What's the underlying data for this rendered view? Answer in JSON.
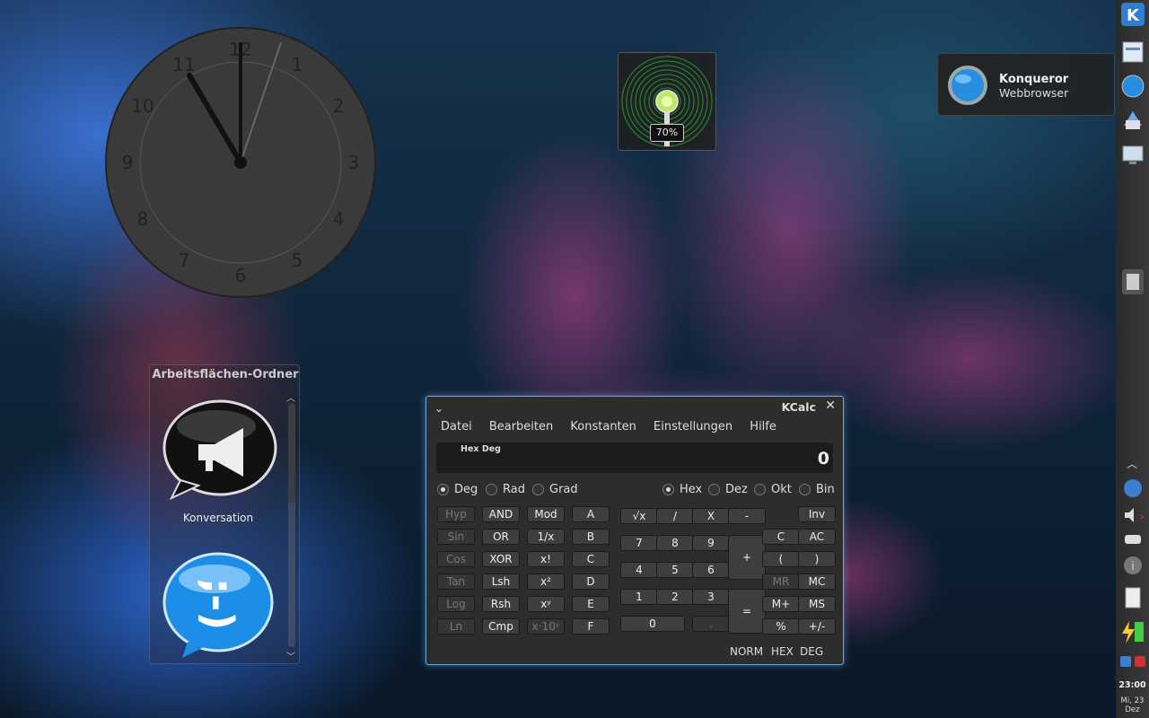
{
  "clock": {
    "numerals": [
      "12",
      "1",
      "2",
      "3",
      "4",
      "5",
      "6",
      "7",
      "8",
      "9",
      "10",
      "11"
    ]
  },
  "meter": {
    "percent_label": "70%",
    "level": 70
  },
  "tooltip": {
    "title": "Konqueror",
    "subtitle": "Webbrowser"
  },
  "folder": {
    "title": "Arbeitsflächen-Ordner",
    "items": [
      "Konversation"
    ]
  },
  "kcalc": {
    "title": "KCalc",
    "menu": [
      "Datei",
      "Bearbeiten",
      "Konstanten",
      "Einstellungen",
      "Hilfe"
    ],
    "display": {
      "status": "Hex Deg",
      "value": "0"
    },
    "angle_modes": [
      "Deg",
      "Rad",
      "Grad"
    ],
    "selected_angle": "Deg",
    "bases": [
      "Hex",
      "Dez",
      "Okt",
      "Bin"
    ],
    "selected_base": "Hex",
    "buttons": {
      "col1": [
        "Hyp",
        "Sin",
        "Cos",
        "Tan",
        "Log",
        "Ln"
      ],
      "col2": [
        "AND",
        "OR",
        "XOR",
        "Lsh",
        "Rsh",
        "Cmp"
      ],
      "col3": [
        "Mod",
        "1/x",
        "x!",
        "x²",
        "xʸ",
        "x·10ʸ"
      ],
      "col4": [
        "A",
        "B",
        "C",
        "D",
        "E",
        "F"
      ],
      "num_row1": [
        "√x",
        "/",
        "X",
        "-"
      ],
      "num_row2": [
        "7",
        "8",
        "9"
      ],
      "num_row3": [
        "4",
        "5",
        "6"
      ],
      "num_row4": [
        "1",
        "2",
        "3"
      ],
      "zero": "0",
      "dot": ".",
      "plus": "+",
      "equals": "=",
      "right1": [
        "Inv"
      ],
      "right2": [
        "C",
        "AC"
      ],
      "right3": [
        "(",
        ")"
      ],
      "right4": [
        "MR",
        "MC"
      ],
      "right5": [
        "M+",
        "MS"
      ],
      "right6": [
        "%",
        "+/-"
      ]
    },
    "statusbar": [
      "NORM",
      "HEX",
      "DEG"
    ]
  },
  "panel": {
    "time": "23:00",
    "date_line1": "Mi, 23",
    "date_line2": "Dez"
  }
}
